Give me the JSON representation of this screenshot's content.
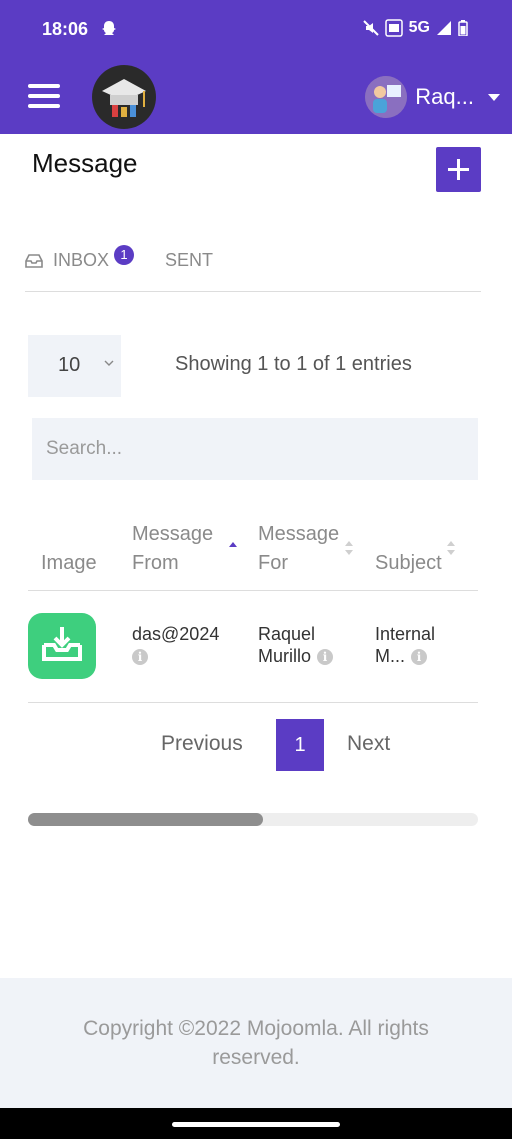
{
  "status_bar": {
    "time": "18:06",
    "network": "5G"
  },
  "app_bar": {
    "user_name": "Raq..."
  },
  "page": {
    "title": "Message"
  },
  "tabs": {
    "inbox_label": "INBOX",
    "inbox_badge": "1",
    "sent_label": "SENT"
  },
  "table_controls": {
    "page_length": "10",
    "entries_info": "Showing 1 to 1 of 1 entries",
    "search_placeholder": "Search..."
  },
  "table": {
    "headers": {
      "image": "Image",
      "message_from": "Message From",
      "message_for": "Message For",
      "subject": "Subject"
    },
    "rows": [
      {
        "message_from": "das@2024",
        "message_for": "Raquel Murillo",
        "subject": "Internal M..."
      }
    ]
  },
  "pagination": {
    "previous": "Previous",
    "current": "1",
    "next": "Next"
  },
  "footer": {
    "copyright": "Copyright ©2022 Mojoomla. All rights reserved."
  },
  "colors": {
    "primary": "#5b3cc4",
    "success": "#3ecf7e",
    "muted": "#8a8a8a"
  }
}
